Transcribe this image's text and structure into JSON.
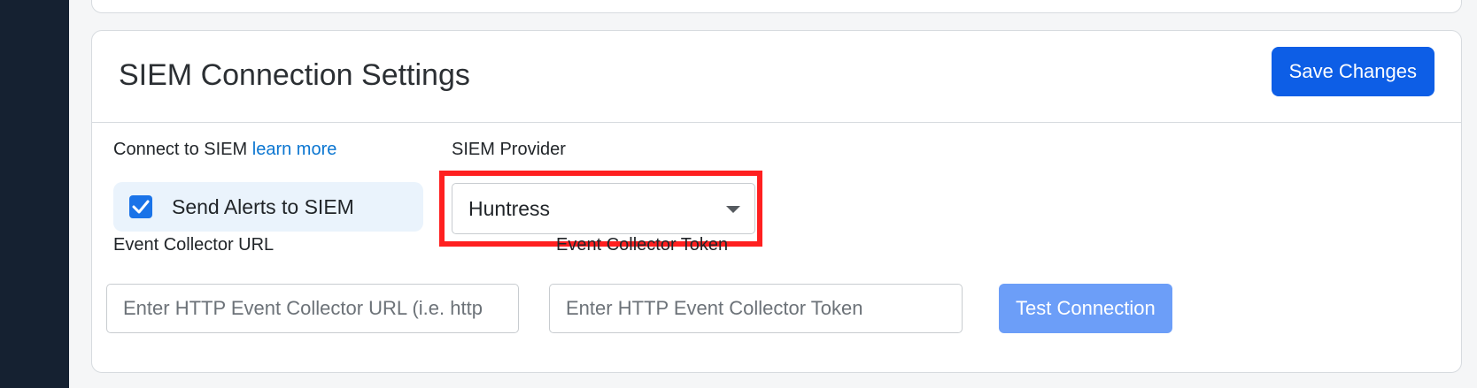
{
  "card": {
    "title": "SIEM Connection Settings",
    "save_label": "Save Changes"
  },
  "connect": {
    "label": "Connect to SIEM",
    "link_text": "learn more",
    "checkbox_label": "Send Alerts to SIEM",
    "checked": true
  },
  "provider": {
    "label": "SIEM Provider",
    "selected": "Huntress"
  },
  "collector_url": {
    "label": "Event Collector URL",
    "placeholder": "Enter HTTP Event Collector URL (i.e. http",
    "value": ""
  },
  "collector_token": {
    "label": "Event Collector Token",
    "placeholder": "Enter HTTP Event Collector Token",
    "value": ""
  },
  "test_button_label": "Test Connection",
  "colors": {
    "primary": "#0d5ee6",
    "primary_disabled": "#6c9ef8",
    "link": "#0b76d1",
    "highlight": "#ff2020",
    "sidebar": "#152131"
  }
}
